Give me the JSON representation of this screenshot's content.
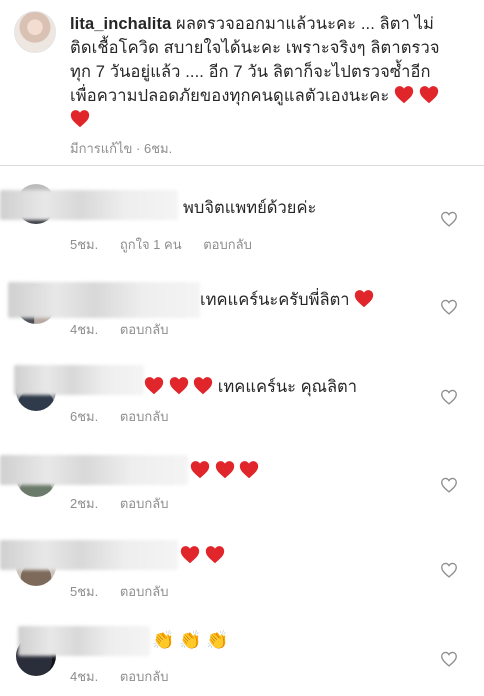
{
  "caption": {
    "username": "lita_inchalita",
    "lines": [
      "ผลตรวจออกมาแล้วนะคะ ... ลิตา ไม่",
      "ติดเชื้อโควิด สบายใจได้นะคะ เพราะจริงๆ ลิตาตรวจ",
      "ทุก 7 วันอยู่แล้ว .... อีก 7 วัน ลิตาก็จะไปตรวจซ้ำอีก",
      "เพื่อความปลอดภัยของทุกคนดูแลตัวเองนะคะ"
    ],
    "edited": "มีการแก้ไข",
    "time": "6ชม."
  },
  "comments": [
    {
      "text": "พบจิตแพทย์ด้วยค่ะ",
      "time": "5ชม.",
      "likes": "ถูกใจ 1 คน",
      "reply": "ตอบกลับ"
    },
    {
      "text": "เทคแคร์นะครับพี่ลิตา",
      "time": "4ชม.",
      "reply": "ตอบกลับ"
    },
    {
      "text": "เทคแคร์นะ คุณลิตา",
      "time": "6ชม.",
      "reply": "ตอบกลับ"
    },
    {
      "text": "",
      "time": "2ชม.",
      "reply": "ตอบกลับ"
    },
    {
      "text": "",
      "time": "5ชม.",
      "reply": "ตอบกลับ"
    },
    {
      "text": "",
      "time": "4ชม.",
      "reply": "ตอบกลับ"
    }
  ],
  "icons": {
    "like": "heart-outline-icon",
    "emoji_heart": "red-heart-emoji",
    "emoji_clap": "clapping-hands-emoji"
  },
  "colors": {
    "heart_red": "#e0252b",
    "meta_gray": "#8e8e8e",
    "text": "#262626"
  }
}
